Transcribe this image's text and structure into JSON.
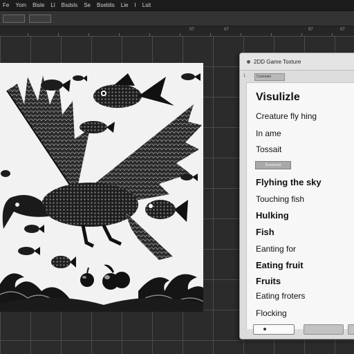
{
  "menubar": {
    "items": [
      "Fe",
      "Yom",
      "Bisle",
      "Ll",
      "Bsdsls",
      "Se",
      "Bseblis",
      "Lie",
      "I",
      "Lsit"
    ]
  },
  "toolbar": {
    "field_a": "",
    "field_b": ""
  },
  "ruler": {
    "labels": [
      "07",
      "07",
      "97",
      "07"
    ]
  },
  "panel": {
    "title": "2DD Game Toxture",
    "subtab": "Cosmaiel",
    "index": "1",
    "tag_button": "Bosebead",
    "items": [
      {
        "text": "Visulizle",
        "style": "title"
      },
      {
        "text": "Creature fly hing",
        "style": "normal"
      },
      {
        "text": "In ame",
        "style": "normal"
      },
      {
        "text": "Tossait",
        "style": "normal"
      },
      {
        "text": "Flyhing the sky",
        "style": "bold"
      },
      {
        "text": "Touching fish",
        "style": "normal"
      },
      {
        "text": "Hulking",
        "style": "bold"
      },
      {
        "text": "Fish",
        "style": "bold"
      },
      {
        "text": "Eanting for",
        "style": "normal"
      },
      {
        "text": "Eating fruit",
        "style": "bold"
      },
      {
        "text": "Fruits",
        "style": "bold"
      },
      {
        "text": "Eating froters",
        "style": "normal"
      },
      {
        "text": "Flocking",
        "style": "normal"
      }
    ]
  },
  "colors": {
    "workspace": "#2b2b2b",
    "grid": "#4b4b4b",
    "panel": "#dcdcdc",
    "canvas": "#f2f2f2"
  },
  "icons": [
    "dot-icon",
    "bird-illustration",
    "fish-icon",
    "apple-icon",
    "wave-icon"
  ]
}
